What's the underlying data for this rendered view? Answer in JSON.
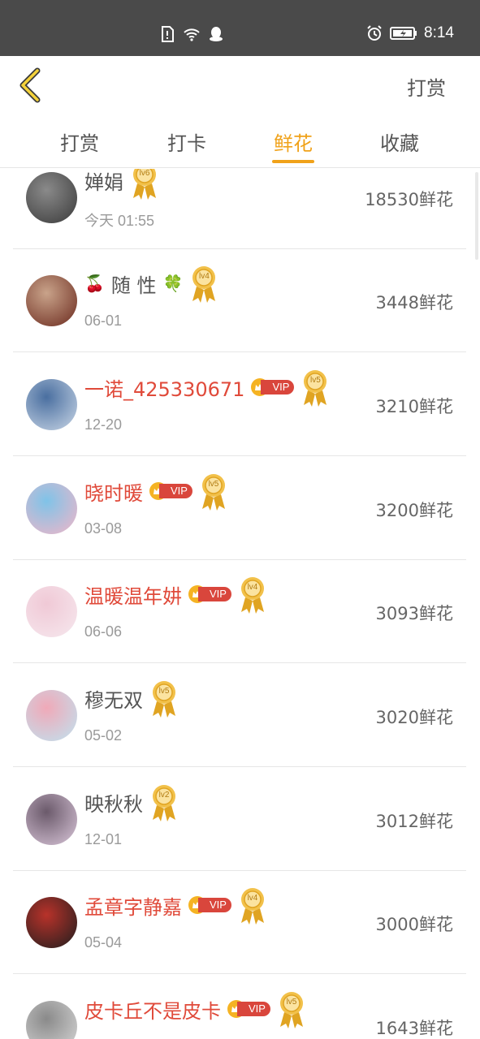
{
  "status_bar": {
    "time": "8:14"
  },
  "header": {
    "action_label": "打赏"
  },
  "tabs": [
    {
      "label": "打赏",
      "active": false
    },
    {
      "label": "打卡",
      "active": false
    },
    {
      "label": "鲜花",
      "active": true
    },
    {
      "label": "收藏",
      "active": false
    }
  ],
  "rows": [
    {
      "name": "婵娟",
      "vip": false,
      "level": "lv6",
      "date": "今天 01:55",
      "count": "18530鲜花"
    },
    {
      "name": "随 性",
      "vip": false,
      "level": "lv4",
      "date": "06-01",
      "count": "3448鲜花",
      "prefix": "🍒",
      "suffix": "🍀"
    },
    {
      "name": "一诺_425330671",
      "vip": true,
      "level": "lv5",
      "date": "12-20",
      "count": "3210鲜花"
    },
    {
      "name": "晓时暖",
      "vip": true,
      "level": "lv5",
      "date": "03-08",
      "count": "3200鲜花"
    },
    {
      "name": "温暖温年妌",
      "vip": true,
      "level": "lv4",
      "date": "06-06",
      "count": "3093鲜花"
    },
    {
      "name": "穆无双",
      "vip": false,
      "level": "lv5",
      "date": "05-02",
      "count": "3020鲜花"
    },
    {
      "name": "映秋秋",
      "vip": false,
      "level": "lv2",
      "date": "12-01",
      "count": "3012鲜花"
    },
    {
      "name": "孟章字静嘉",
      "vip": true,
      "level": "lv4",
      "date": "05-04",
      "count": "3000鲜花"
    },
    {
      "name": "皮卡丘不是皮卡",
      "vip": true,
      "level": "lv5",
      "date": "",
      "count": "1643鲜花"
    }
  ],
  "vip_label": "VIP",
  "colors": {
    "accent": "#f0a21a",
    "vip_name": "#e04a3a",
    "status_bar": "#4a4a4a"
  }
}
